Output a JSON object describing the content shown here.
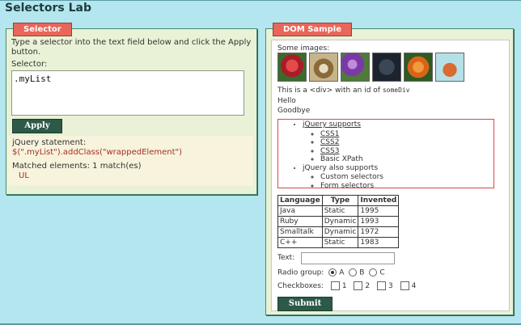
{
  "page": {
    "title": "Selectors Lab"
  },
  "selector_panel": {
    "title": "Selector",
    "instructions": "Type a selector into the text field below and click the Apply button.",
    "selector_label": "Selector:",
    "selector_value": ".myList",
    "apply_label": "Apply",
    "statement_label": "jQuery statement:",
    "statement_code": "$(\".myList\").addClass(\"wrappedElement\")",
    "matched_label": "Matched elements: 1 match(es)",
    "matched_items": [
      "UL"
    ]
  },
  "dom_panel": {
    "title": "DOM Sample",
    "images_label": "Some images:",
    "images": [
      {
        "icon": "flower-red-image",
        "color": "#c9283a"
      },
      {
        "icon": "dog-image",
        "color": "#8a6a3a"
      },
      {
        "icon": "flower-purple-image",
        "color": "#8a4bb0"
      },
      {
        "icon": "cat-image",
        "color": "#2e3a4a"
      },
      {
        "icon": "flower-orange-image",
        "color": "#d8641a"
      },
      {
        "icon": "teapot-image",
        "color": "#c25a2a"
      }
    ],
    "div_text_prefix": "This is a <div> with an id of",
    "div_id": "someDiv",
    "hello": "Hello",
    "goodbye": "Goodbye",
    "list": {
      "item1": "jQuery supports",
      "sub1": [
        "CSS1",
        "CSS2",
        "CSS3"
      ],
      "sub1_plain": "Basic XPath",
      "item2": "jQuery also supports",
      "sub2": [
        "Custom selectors",
        "Form selectors"
      ]
    },
    "table": {
      "headers": [
        "Language",
        "Type",
        "Invented"
      ],
      "rows": [
        [
          "Java",
          "Static",
          "1995"
        ],
        [
          "Ruby",
          "Dynamic",
          "1993"
        ],
        [
          "Smalltalk",
          "Dynamic",
          "1972"
        ],
        [
          "C++",
          "Static",
          "1983"
        ]
      ]
    },
    "form": {
      "text_label": "Text:",
      "radio_label": "Radio group:",
      "radios": [
        "A",
        "B",
        "C"
      ],
      "radio_selected": "A",
      "check_label": "Checkboxes:",
      "checks": [
        "1",
        "2",
        "3",
        "4"
      ],
      "submit_label": "Submit"
    }
  }
}
